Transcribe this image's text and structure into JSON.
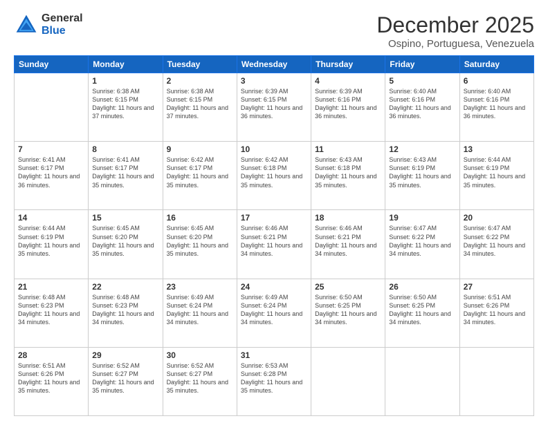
{
  "header": {
    "logo_general": "General",
    "logo_blue": "Blue",
    "month_title": "December 2025",
    "location": "Ospino, Portuguesa, Venezuela"
  },
  "days_of_week": [
    "Sunday",
    "Monday",
    "Tuesday",
    "Wednesday",
    "Thursday",
    "Friday",
    "Saturday"
  ],
  "weeks": [
    [
      {
        "day": "",
        "info": ""
      },
      {
        "day": "1",
        "info": "Sunrise: 6:38 AM\nSunset: 6:15 PM\nDaylight: 11 hours and 37 minutes."
      },
      {
        "day": "2",
        "info": "Sunrise: 6:38 AM\nSunset: 6:15 PM\nDaylight: 11 hours and 37 minutes."
      },
      {
        "day": "3",
        "info": "Sunrise: 6:39 AM\nSunset: 6:15 PM\nDaylight: 11 hours and 36 minutes."
      },
      {
        "day": "4",
        "info": "Sunrise: 6:39 AM\nSunset: 6:16 PM\nDaylight: 11 hours and 36 minutes."
      },
      {
        "day": "5",
        "info": "Sunrise: 6:40 AM\nSunset: 6:16 PM\nDaylight: 11 hours and 36 minutes."
      },
      {
        "day": "6",
        "info": "Sunrise: 6:40 AM\nSunset: 6:16 PM\nDaylight: 11 hours and 36 minutes."
      }
    ],
    [
      {
        "day": "7",
        "info": "Sunrise: 6:41 AM\nSunset: 6:17 PM\nDaylight: 11 hours and 36 minutes."
      },
      {
        "day": "8",
        "info": "Sunrise: 6:41 AM\nSunset: 6:17 PM\nDaylight: 11 hours and 35 minutes."
      },
      {
        "day": "9",
        "info": "Sunrise: 6:42 AM\nSunset: 6:17 PM\nDaylight: 11 hours and 35 minutes."
      },
      {
        "day": "10",
        "info": "Sunrise: 6:42 AM\nSunset: 6:18 PM\nDaylight: 11 hours and 35 minutes."
      },
      {
        "day": "11",
        "info": "Sunrise: 6:43 AM\nSunset: 6:18 PM\nDaylight: 11 hours and 35 minutes."
      },
      {
        "day": "12",
        "info": "Sunrise: 6:43 AM\nSunset: 6:19 PM\nDaylight: 11 hours and 35 minutes."
      },
      {
        "day": "13",
        "info": "Sunrise: 6:44 AM\nSunset: 6:19 PM\nDaylight: 11 hours and 35 minutes."
      }
    ],
    [
      {
        "day": "14",
        "info": "Sunrise: 6:44 AM\nSunset: 6:19 PM\nDaylight: 11 hours and 35 minutes."
      },
      {
        "day": "15",
        "info": "Sunrise: 6:45 AM\nSunset: 6:20 PM\nDaylight: 11 hours and 35 minutes."
      },
      {
        "day": "16",
        "info": "Sunrise: 6:45 AM\nSunset: 6:20 PM\nDaylight: 11 hours and 35 minutes."
      },
      {
        "day": "17",
        "info": "Sunrise: 6:46 AM\nSunset: 6:21 PM\nDaylight: 11 hours and 34 minutes."
      },
      {
        "day": "18",
        "info": "Sunrise: 6:46 AM\nSunset: 6:21 PM\nDaylight: 11 hours and 34 minutes."
      },
      {
        "day": "19",
        "info": "Sunrise: 6:47 AM\nSunset: 6:22 PM\nDaylight: 11 hours and 34 minutes."
      },
      {
        "day": "20",
        "info": "Sunrise: 6:47 AM\nSunset: 6:22 PM\nDaylight: 11 hours and 34 minutes."
      }
    ],
    [
      {
        "day": "21",
        "info": "Sunrise: 6:48 AM\nSunset: 6:23 PM\nDaylight: 11 hours and 34 minutes."
      },
      {
        "day": "22",
        "info": "Sunrise: 6:48 AM\nSunset: 6:23 PM\nDaylight: 11 hours and 34 minutes."
      },
      {
        "day": "23",
        "info": "Sunrise: 6:49 AM\nSunset: 6:24 PM\nDaylight: 11 hours and 34 minutes."
      },
      {
        "day": "24",
        "info": "Sunrise: 6:49 AM\nSunset: 6:24 PM\nDaylight: 11 hours and 34 minutes."
      },
      {
        "day": "25",
        "info": "Sunrise: 6:50 AM\nSunset: 6:25 PM\nDaylight: 11 hours and 34 minutes."
      },
      {
        "day": "26",
        "info": "Sunrise: 6:50 AM\nSunset: 6:25 PM\nDaylight: 11 hours and 34 minutes."
      },
      {
        "day": "27",
        "info": "Sunrise: 6:51 AM\nSunset: 6:26 PM\nDaylight: 11 hours and 34 minutes."
      }
    ],
    [
      {
        "day": "28",
        "info": "Sunrise: 6:51 AM\nSunset: 6:26 PM\nDaylight: 11 hours and 35 minutes."
      },
      {
        "day": "29",
        "info": "Sunrise: 6:52 AM\nSunset: 6:27 PM\nDaylight: 11 hours and 35 minutes."
      },
      {
        "day": "30",
        "info": "Sunrise: 6:52 AM\nSunset: 6:27 PM\nDaylight: 11 hours and 35 minutes."
      },
      {
        "day": "31",
        "info": "Sunrise: 6:53 AM\nSunset: 6:28 PM\nDaylight: 11 hours and 35 minutes."
      },
      {
        "day": "",
        "info": ""
      },
      {
        "day": "",
        "info": ""
      },
      {
        "day": "",
        "info": ""
      }
    ]
  ]
}
